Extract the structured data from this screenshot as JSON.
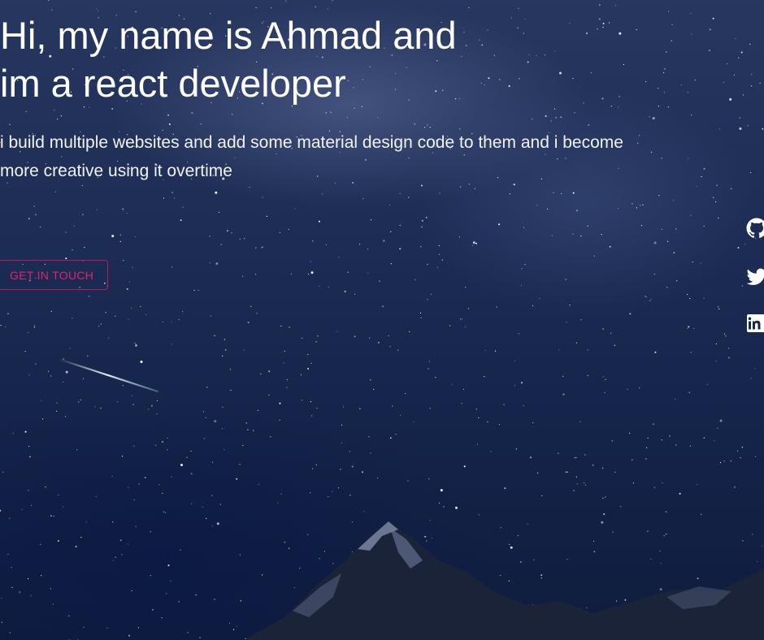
{
  "hero": {
    "headline_line1": "Hi, my name is Ahmad and",
    "headline_line2": "im a react developer",
    "subtitle_line1": "i build multiple websites and add some material design code to them and i become",
    "subtitle_line2": "more creative using it overtime",
    "cta_label": "GET IN TOUCH"
  },
  "social": [
    {
      "icon": "github-icon",
      "label": "GitHub"
    },
    {
      "icon": "twitter-icon",
      "label": "Twitter"
    },
    {
      "icon": "linkedin-icon",
      "label": "LinkedIn"
    }
  ],
  "colors": {
    "accent": "#e0246b",
    "text": "#ffffff",
    "background": "#1d2d55"
  }
}
